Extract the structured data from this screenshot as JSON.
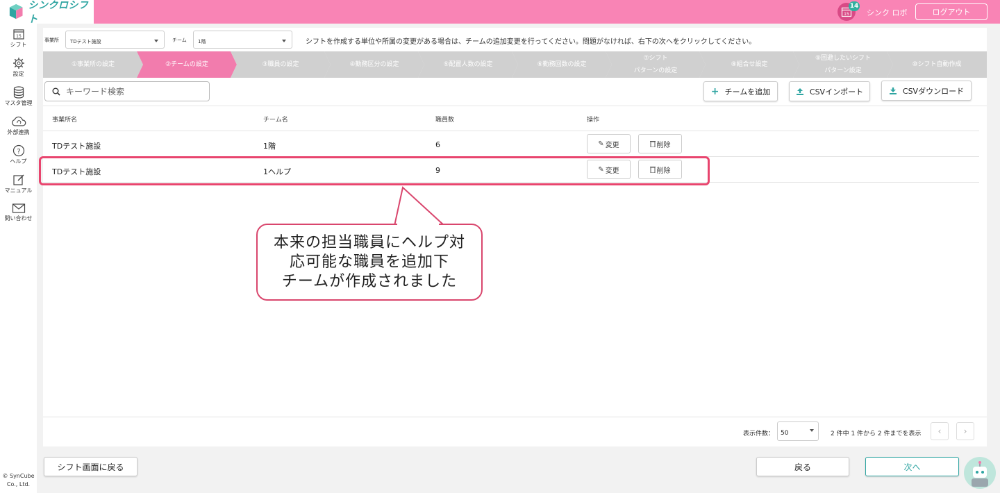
{
  "header": {
    "app_name": "シンクロシフト",
    "calendar_day": "15",
    "notification_count": "14",
    "user_name": "シンク ロボ",
    "logout_label": "ログアウト"
  },
  "sidebar": {
    "items": [
      {
        "label": "シフト",
        "icon": "calendar-icon"
      },
      {
        "label": "設定",
        "icon": "gear-icon"
      },
      {
        "label": "マスタ管理",
        "icon": "database-icon"
      },
      {
        "label": "外部連携",
        "icon": "cloud-sync-icon"
      },
      {
        "label": "ヘルプ",
        "icon": "help-icon"
      },
      {
        "label": "マニュアル",
        "icon": "edit-icon"
      },
      {
        "label": "問い合わせ",
        "icon": "mail-icon"
      }
    ],
    "copyright": "© SynCube Co., Ltd."
  },
  "filters": {
    "office_label": "事業所",
    "office_value": "TDテスト施設",
    "team_label": "チーム",
    "team_value": "1階",
    "message": "シフトを作成する単位や所属の変更がある場合は、チームの追加変更を行ってください。問題がなければ、右下の次へをクリックしてください。"
  },
  "steps": [
    {
      "label": "①事業所の設定",
      "active": false
    },
    {
      "label": "②チームの設定",
      "active": true
    },
    {
      "label": "③職員の設定",
      "active": false
    },
    {
      "label": "④勤務区分の設定",
      "active": false
    },
    {
      "label": "⑤配置人数の設定",
      "active": false
    },
    {
      "label": "⑥勤務回数の設定",
      "active": false
    },
    {
      "label": "⑦シフト\nパターンの設定",
      "active": false
    },
    {
      "label": "⑧組合せ設定",
      "active": false
    },
    {
      "label": "⑨回避したいシフト\nパターン設定",
      "active": false
    },
    {
      "label": "⑩シフト自動作成",
      "active": false
    }
  ],
  "toolbar": {
    "search_placeholder": "キーワード検索",
    "add_team_label": "チームを追加",
    "csv_import_label": "CSVインポート",
    "csv_download_label": "CSVダウンロード"
  },
  "table": {
    "columns": [
      "事業所名",
      "チーム名",
      "職員数",
      "操作"
    ],
    "rows": [
      {
        "office": "TDテスト施設",
        "team": "1階",
        "staff": "6"
      },
      {
        "office": "TDテスト施設",
        "team": "1ヘルプ",
        "staff": "9"
      }
    ],
    "edit_label": "変更",
    "delete_label": "削除"
  },
  "pager": {
    "per_page_label": "表示件数：",
    "per_page_value": "50",
    "summary": "2 件中 1 件から 2 件までを表示"
  },
  "footer": {
    "back_to_shift_label": "シフト画面に戻る",
    "back_label": "戻る",
    "next_label": "次へ"
  },
  "callout": {
    "text": "本来の担当職員にヘルプ対\n応可能な職員を追加下\nチームが作成されました"
  },
  "colors": {
    "brand_pink": "#f984b5",
    "active_step": "#f27cad",
    "teal": "#2fa5a2",
    "highlight": "#e8456e"
  }
}
